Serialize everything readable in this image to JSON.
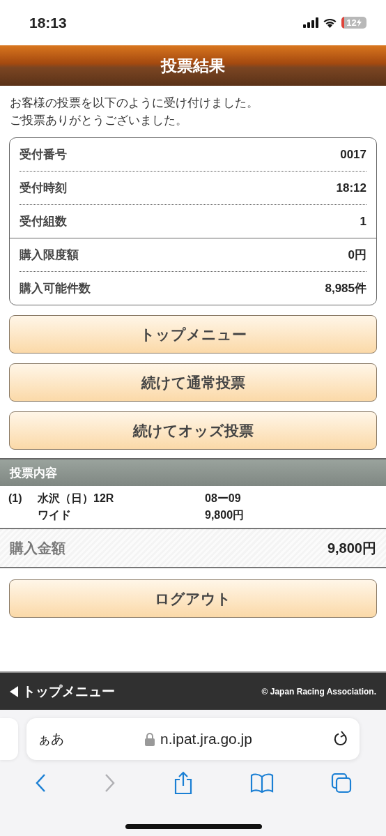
{
  "status_bar": {
    "time": "18:13",
    "battery": "12"
  },
  "header": {
    "title": "投票結果"
  },
  "message": [
    "お客様の投票を以下のように受け付けました。",
    "ご投票ありがとうございました。"
  ],
  "receipt": {
    "sections": [
      [
        {
          "label": "受付番号",
          "value": "0017"
        },
        {
          "label": "受付時刻",
          "value": "18:12"
        },
        {
          "label": "受付組数",
          "value": "1"
        }
      ],
      [
        {
          "label": "購入限度額",
          "value": "0円"
        },
        {
          "label": "購入可能件数",
          "value": "8,985件"
        }
      ]
    ]
  },
  "buttons": [
    "トップメニュー",
    "続けて通常投票",
    "続けてオッズ投票"
  ],
  "bet_section": {
    "title": "投票内容",
    "bets": [
      {
        "number": "(1)",
        "race": "水沢（日）12R",
        "combination": "08ー09",
        "type": "ワイド",
        "amount": "9,800円"
      }
    ]
  },
  "total": {
    "label": "購入金額",
    "value": "9,800円"
  },
  "logout_button": "ログアウト",
  "footer": {
    "link": "トップメニュー",
    "copyright": "© Japan Racing Association."
  },
  "browser": {
    "text_size": "ぁあ",
    "url": "n.ipat.jra.go.jp",
    "toolbar": [
      {
        "kind": "back",
        "disabled": false
      },
      {
        "kind": "forward",
        "disabled": true
      },
      {
        "kind": "share",
        "disabled": false
      },
      {
        "kind": "bookmarks",
        "disabled": false
      },
      {
        "kind": "tabs",
        "disabled": false
      }
    ]
  }
}
